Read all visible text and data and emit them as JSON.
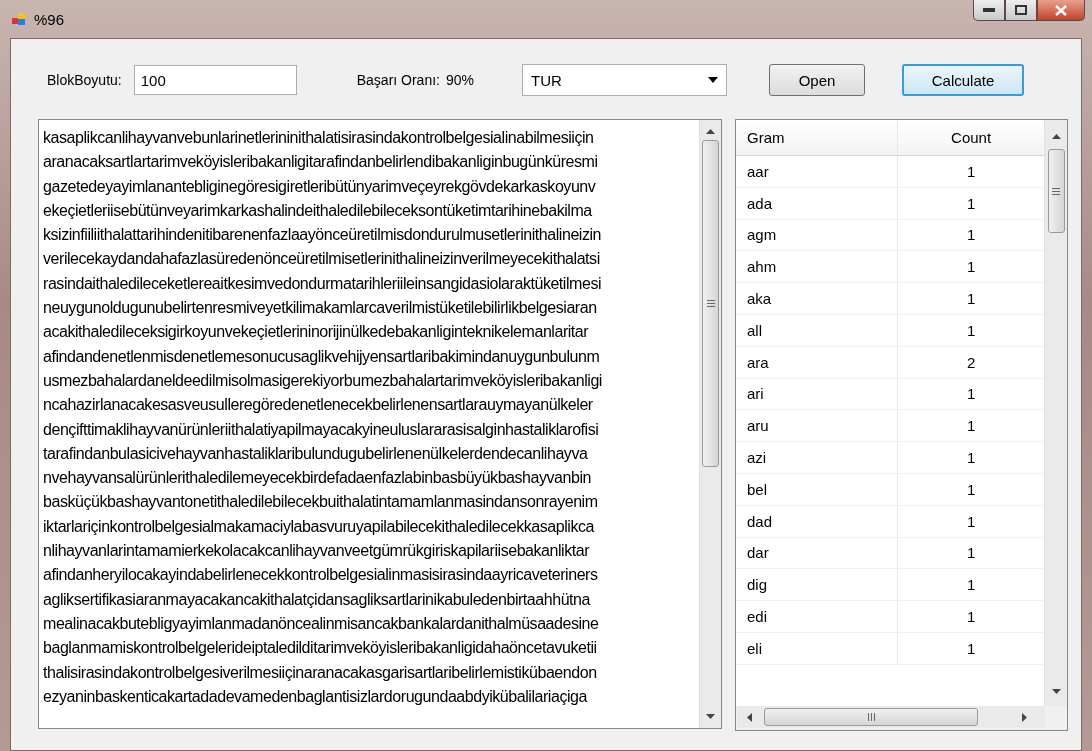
{
  "window": {
    "title": "%96"
  },
  "toolbar": {
    "block_size_label": "BlokBoyutu:",
    "block_size_value": "100",
    "success_rate_label": "Başarı Oranı:",
    "success_rate_value": "90%",
    "language": "TUR",
    "buttons": [
      {
        "label": "Open",
        "focused": false
      },
      {
        "label": "Calculate",
        "focused": true
      }
    ]
  },
  "text_lines": [
    "kasaplikcanlihayvanvebunlarinetlerininithalatisirasindakontrolbelgesialinabilmesiiçin",
    "aranacaksartlartarimveköyisleribakanligitarafindanbelirlendibakanliginbugünküresmi",
    "gazetedeyayimlanantebliginegöresigiretleribütünyarimveçeyrekgövdekarkaskoyunv",
    "ekeçietleriisebütünveyarimkarkashalindeithaledilebileceksontüketimtarihinebakilma",
    "ksizinfiiliithalattarihindenitibarenenfazlaayönceüretilmisdondurulmusetlerinithalineizin",
    "verilecekaydandahafazlasüredenönceüretilmisetlerinithalineizinverilmeyecekithalatsi",
    "rasindaithaledileceketlereaitkesimvedondurmatarihleriileinsangidasiolaraktüketilmesi",
    "neuygunoldugunubelirtenresmiveyetkilimakamlarcaverilmistüketilebilirlikbelgesiaran",
    "acakithaledileceksigirkoyunvekeçietlerininorijinülkedebakanliginteknikelemanlaritar",
    "afindandenetlenmisdenetlemesonucusaglikvehijyensartlaribakimindanuygunbulunm",
    "usmezbahalardaneldeedilmisolmasigerekiyorbumezbahalartarimveköyisleribakanligi",
    "ncahazirlanacakesasveusulleregöredenetlenecekbelirlenensartlarauymayanülkeler",
    "dençifttimaklihayvanürünleriithalatiyapilmayacakyineuluslararasisalginhastaliklarofisi",
    "tarafindanbulasicivehayvanhastaliklaribulundugubelirlenenülkelerdendecanlihayva",
    "nvehayvansalürünlerithaledilemeyecekbirdefadaenfazlabinbasbüyükbashayvanbin",
    "basküçükbashayvantonetithaledilebilecekbuithalatintamamlanmasindansonrayenim",
    "iktarlariçinkontrolbelgesialmakamaciylabasvuruyapilabilecekithaledilecekkasaplikca",
    "nlihayvanlarintamamierkekolacakcanlihayvanveetgümrükgiriskapilariisebakanliktar",
    "afindanheryilocakayindabelirlenecekkontrolbelgesialinmasisirasindaayricaveteriners",
    "agliksertifikasiaranmayacakancakithalatçidansagliksartlarinikabuledenbirtaahhütna",
    "mealinacakbutebligyayimlanmadanöncealinmisancakbankalardanithalmüsaadesine",
    "baglanmamiskontrolbelgelerideiptaledilditarimveköyisleribakanligidahaöncetavuketii",
    "thalisirasindakontrolbelgesiverilmesiiçinaranacakasgarisartlaribelirlemistikübaendon",
    "ezyaninbaskenticakartadadevamedenbaglantisizlardorugundaabdyikübalilariaçiga"
  ],
  "grid": {
    "columns": [
      "Gram",
      "Count"
    ],
    "rows": [
      [
        "aar",
        "1"
      ],
      [
        "ada",
        "1"
      ],
      [
        "agm",
        "1"
      ],
      [
        "ahm",
        "1"
      ],
      [
        "aka",
        "1"
      ],
      [
        "all",
        "1"
      ],
      [
        "ara",
        "2"
      ],
      [
        "ari",
        "1"
      ],
      [
        "aru",
        "1"
      ],
      [
        "azi",
        "1"
      ],
      [
        "bel",
        "1"
      ],
      [
        "dad",
        "1"
      ],
      [
        "dar",
        "1"
      ],
      [
        "dig",
        "1"
      ],
      [
        "edi",
        "1"
      ],
      [
        "eli",
        "1"
      ]
    ]
  }
}
